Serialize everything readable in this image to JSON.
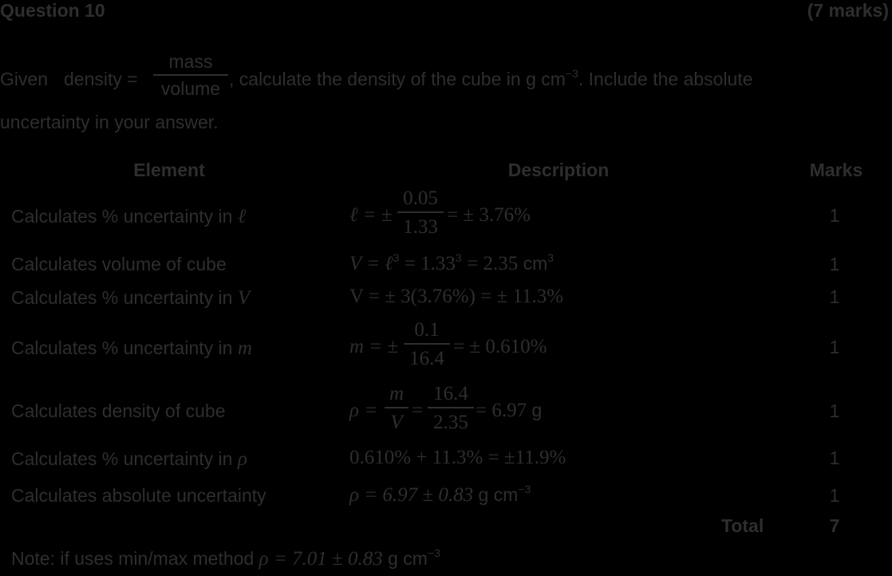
{
  "header": {
    "question": "Question 10",
    "marks": "(7 marks)"
  },
  "prompt": {
    "given": "Given",
    "formula_lhs": "density =",
    "formula_num": "mass",
    "formula_den": "volume",
    "text_line1": ", calculate the density of the cube in g cm",
    "text_line1_exp": "−3",
    "text_line1_end": ". Include the absolute",
    "text_line2": "uncertainty in your answer."
  },
  "table": {
    "headers": {
      "element": "Element",
      "description": "Description",
      "marks": "Marks"
    },
    "rows": [
      {
        "element": "Calculates % uncertainty in",
        "element_symbol": "ℓ",
        "desc_lhs": "ℓ = ±",
        "desc_num": "0.05",
        "desc_den": "1.33",
        "desc_rhs": "= ± 3.76%",
        "marks": "1"
      },
      {
        "element": "Calculates volume of cube",
        "desc_math": "V = ℓ",
        "desc_exp1": "3",
        "desc_math2": "= 1.33",
        "desc_exp2": "3",
        "desc_math3": "= 2.35",
        "desc_unit": "cm",
        "desc_unit_exp": "3",
        "marks": "1"
      },
      {
        "element": "Calculates % uncertainty in",
        "element_symbol": "V",
        "desc_math": "V = ± 3(3.76%) = ± 11.3%",
        "marks": "1"
      },
      {
        "element": "Calculates % uncertainty in",
        "element_symbol": "m",
        "desc_lhs": "m = ±",
        "desc_num": "0.1",
        "desc_den": "16.4",
        "desc_rhs": "= ± 0.610%",
        "marks": "1"
      },
      {
        "element": "Calculates density of cube",
        "desc_lhs": "ρ =",
        "desc_num1": "m",
        "desc_den1": "V",
        "desc_eq": "=",
        "desc_num2": "16.4",
        "desc_den2": "2.35",
        "desc_rhs": "= 6.97",
        "desc_unit": "g",
        "marks": "1"
      },
      {
        "element": "Calculates % uncertainty in",
        "element_symbol": "ρ",
        "desc_math": "0.610% + 11.3% = ±11.9%",
        "marks": "1"
      },
      {
        "element": "Calculates absolute uncertainty",
        "desc_math": "ρ = 6.97 ± 0.83",
        "desc_unit": "g cm",
        "desc_unit_exp": "−3",
        "marks": "1"
      }
    ],
    "total_label": "Total",
    "total_marks": "7"
  },
  "note": {
    "text": "Note: if uses min/max method",
    "math": "ρ = 7.01 ± 0.83",
    "unit": "g cm",
    "unit_exp": "−3"
  }
}
